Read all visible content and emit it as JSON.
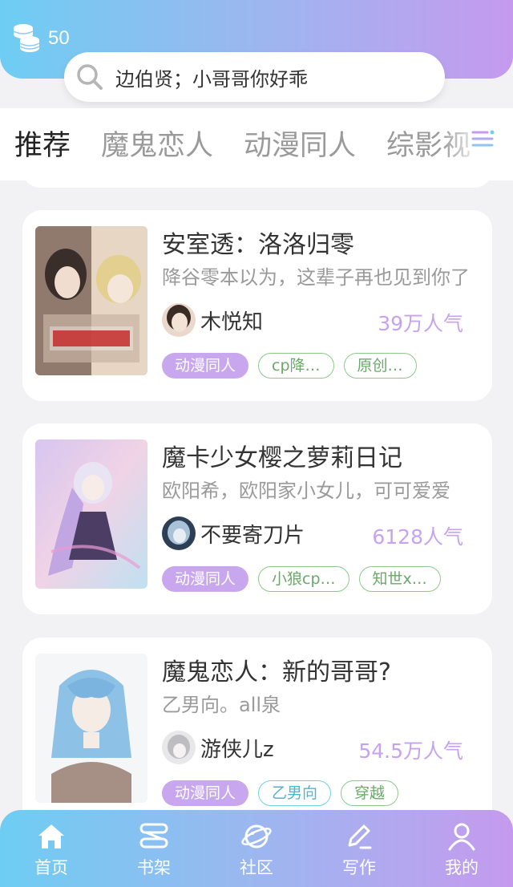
{
  "header": {
    "coins": "50"
  },
  "search": {
    "text": "边伯贤；小哥哥你好乖"
  },
  "tabs": [
    {
      "label": "推荐",
      "active": true
    },
    {
      "label": "魔鬼恋人",
      "active": false
    },
    {
      "label": "动漫同人",
      "active": false
    },
    {
      "label": "综影视",
      "active": false
    }
  ],
  "books": [
    {
      "title": "安室透：洛洛归零",
      "desc": "降谷零本以为，这辈子再也见到你了",
      "author": "木悦知",
      "popularity": "39万人气",
      "tags": [
        {
          "label": "动漫同人",
          "style": "fill"
        },
        {
          "label": "cp降…",
          "style": "green"
        },
        {
          "label": "原创…",
          "style": "green"
        }
      ]
    },
    {
      "title": "魔卡少女樱之萝莉日记",
      "desc": "欧阳希，欧阳家小女儿，可可爱爱",
      "author": "不要寄刀片",
      "popularity": "6128人气",
      "tags": [
        {
          "label": "动漫同人",
          "style": "fill"
        },
        {
          "label": "小狼cp…",
          "style": "green"
        },
        {
          "label": "知世x…",
          "style": "green"
        }
      ]
    },
    {
      "title": "魔鬼恋人：新的哥哥?",
      "desc": "乙男向。all泉",
      "author": "游侠儿z",
      "popularity": "54.5万人气",
      "tags": [
        {
          "label": "动漫同人",
          "style": "fill"
        },
        {
          "label": "乙男向",
          "style": "cyan"
        },
        {
          "label": "穿越",
          "style": "green"
        }
      ]
    }
  ],
  "nav": [
    {
      "label": "首页",
      "icon": "home-icon"
    },
    {
      "label": "书架",
      "icon": "bookshelf-icon"
    },
    {
      "label": "社区",
      "icon": "community-icon"
    },
    {
      "label": "写作",
      "icon": "write-icon"
    },
    {
      "label": "我的",
      "icon": "profile-icon"
    }
  ]
}
